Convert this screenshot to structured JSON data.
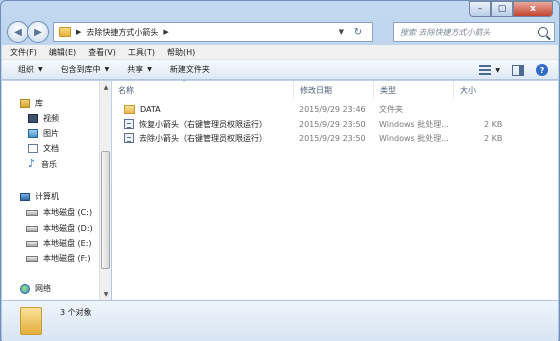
{
  "window": {
    "caption_minimize": "–",
    "caption_maximize": "▢",
    "caption_close": "x"
  },
  "nav": {
    "back_glyph": "◀",
    "forward_glyph": "▶",
    "address_sep_glyph": "▶",
    "address_path": "去除快捷方式小箭头",
    "address_trailing_glyph": "▶",
    "refresh_glyph": "↻",
    "search_placeholder": "搜索 去除快捷方式小箭头"
  },
  "menubar": {
    "items": [
      "文件(F)",
      "编辑(E)",
      "查看(V)",
      "工具(T)",
      "帮助(H)"
    ]
  },
  "cmdbar": {
    "organize": "组织",
    "include": "包含到库中",
    "share": "共享",
    "new_folder": "新建文件夹",
    "arrow_glyph": "▼"
  },
  "navpane": {
    "library": "库",
    "video": "视频",
    "pictures": "图片",
    "documents": "文档",
    "music": "音乐",
    "computer": "计算机",
    "drive_c": "本地磁盘 (C:)",
    "drive_d": "本地磁盘 (D:)",
    "drive_e": "本地磁盘 (E:)",
    "drive_f": "本地磁盘 (F:)",
    "network": "网络"
  },
  "columns": {
    "name": "名称",
    "modified": "修改日期",
    "type": "类型",
    "size": "大小",
    "sort_glyph": "^"
  },
  "files": [
    {
      "name": "DATA",
      "modified": "2015/9/29 23:46",
      "type": "文件夹",
      "size": ""
    },
    {
      "name": "恢复小箭头（右键管理员权限运行）",
      "modified": "2015/9/29 23:50",
      "type": "Windows 批处理...",
      "size": "2 KB"
    },
    {
      "name": "去除小箭头（右键管理员权限运行）",
      "modified": "2015/9/29 23:50",
      "type": "Windows 批处理...",
      "size": "2 KB"
    }
  ],
  "status": {
    "count_text": "3 个对象"
  }
}
